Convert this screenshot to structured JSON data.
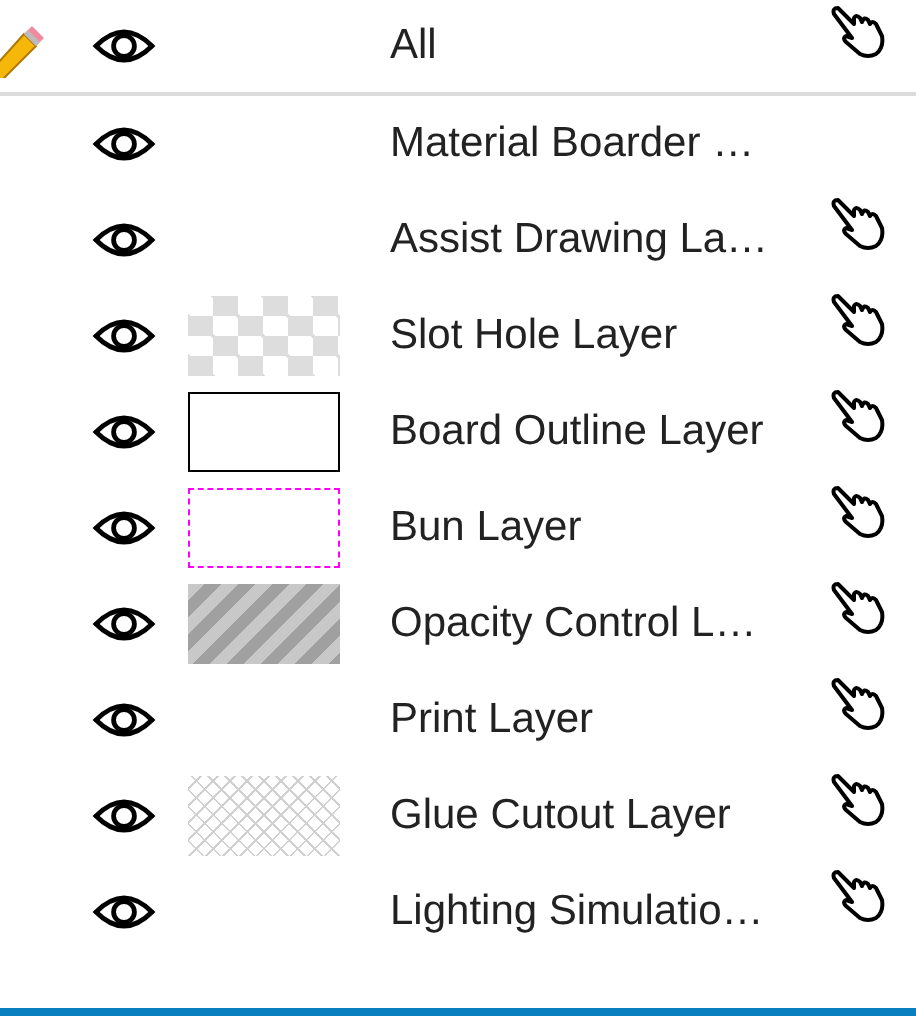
{
  "header": {
    "label": "All",
    "visible": true,
    "pointer": true
  },
  "layers": [
    {
      "name": "Material Boarder …",
      "visible": true,
      "kind": "plain",
      "pointer": false
    },
    {
      "name": "Assist Drawing La…",
      "visible": true,
      "kind": "plain",
      "pointer": true
    },
    {
      "name": "Slot Hole Layer",
      "visible": true,
      "kind": "checker",
      "pointer": true
    },
    {
      "name": "Board Outline Layer",
      "visible": true,
      "kind": "outline",
      "pointer": true
    },
    {
      "name": "Bun Layer",
      "visible": true,
      "kind": "dashdot",
      "pointer": true
    },
    {
      "name": "Opacity Control L…",
      "visible": true,
      "kind": "stripes",
      "pointer": true
    },
    {
      "name": "Print Layer",
      "visible": true,
      "kind": "plain",
      "pointer": true
    },
    {
      "name": "Glue Cutout Layer",
      "visible": true,
      "kind": "crosshatch",
      "pointer": true
    },
    {
      "name": "Lighting Simulatio…",
      "visible": true,
      "kind": "plain",
      "pointer": true
    }
  ]
}
